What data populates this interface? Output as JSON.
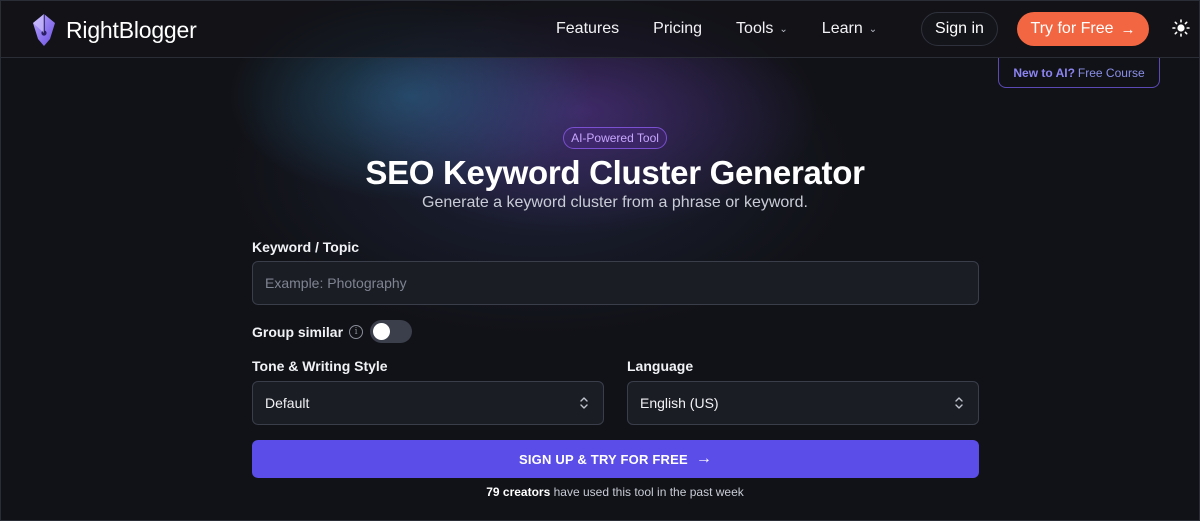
{
  "brand": {
    "name": "RightBlogger",
    "logo_icon": "pen-nib-icon"
  },
  "nav": {
    "items": [
      {
        "label": "Features",
        "has_dropdown": false
      },
      {
        "label": "Pricing",
        "has_dropdown": false
      },
      {
        "label": "Tools",
        "has_dropdown": true
      },
      {
        "label": "Learn",
        "has_dropdown": true
      }
    ],
    "signin_label": "Sign in",
    "try_label": "Try for Free",
    "theme_icon": "sun-icon"
  },
  "promo": {
    "bold": "New to AI?",
    "text": "Free Course"
  },
  "hero": {
    "badge": "AI-Powered Tool",
    "title": "SEO Keyword Cluster Generator",
    "subtitle": "Generate a keyword cluster from a phrase or keyword."
  },
  "form": {
    "keyword_label": "Keyword / Topic",
    "keyword_placeholder": "Example: Photography",
    "keyword_value": "",
    "group_label": "Group similar",
    "group_enabled": false,
    "tone_label": "Tone & Writing Style",
    "tone_value": "Default",
    "language_label": "Language",
    "language_value": "English (US)",
    "cta_label": "SIGN UP & TRY FOR FREE",
    "footnote_bold": "79 creators",
    "footnote_rest": "have used this tool in the past week"
  },
  "colors": {
    "accent": "#5b4de8",
    "try_button": "#f26641",
    "badge": "#c7a6ff",
    "background": "#111217"
  }
}
